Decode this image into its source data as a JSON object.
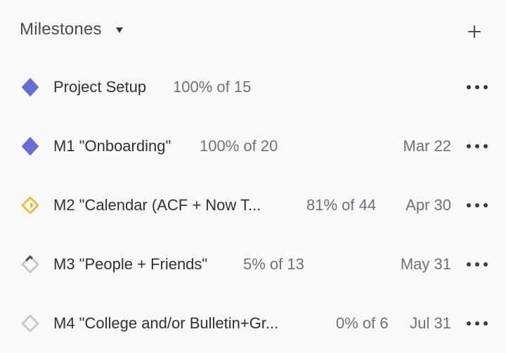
{
  "header": {
    "title": "Milestones",
    "dropdown_icon": "caret-down-icon",
    "add_icon": "plus-icon"
  },
  "colors": {
    "complete": "#6b6bd6",
    "in_progress": "#e9be3d",
    "not_started": "#c8c8cc",
    "started_edge": "#4a4b52"
  },
  "milestones": [
    {
      "name": "Project Setup",
      "progress": "100% of 15",
      "progress_fraction": 1.0,
      "date": "",
      "status": "complete",
      "menu_icon": "more-horizontal-icon"
    },
    {
      "name": "M1 \"Onboarding\"",
      "progress": "100% of 20",
      "progress_fraction": 1.0,
      "date": "Mar 22",
      "status": "complete",
      "menu_icon": "more-horizontal-icon"
    },
    {
      "name": "M2 \"Calendar (ACF + Now T...",
      "progress": "81% of 44",
      "progress_fraction": 0.81,
      "date": "Apr 30",
      "status": "in-progress",
      "menu_icon": "more-horizontal-icon"
    },
    {
      "name": "M3 \"People + Friends\"",
      "progress": "5% of 13",
      "progress_fraction": 0.05,
      "date": "May 31",
      "status": "started",
      "menu_icon": "more-horizontal-icon"
    },
    {
      "name": "M4 \"College and/or Bulletin+Gr...",
      "progress": "0% of 6",
      "progress_fraction": 0.0,
      "date": "Jul 31",
      "status": "not-started",
      "menu_icon": "more-horizontal-icon"
    }
  ]
}
